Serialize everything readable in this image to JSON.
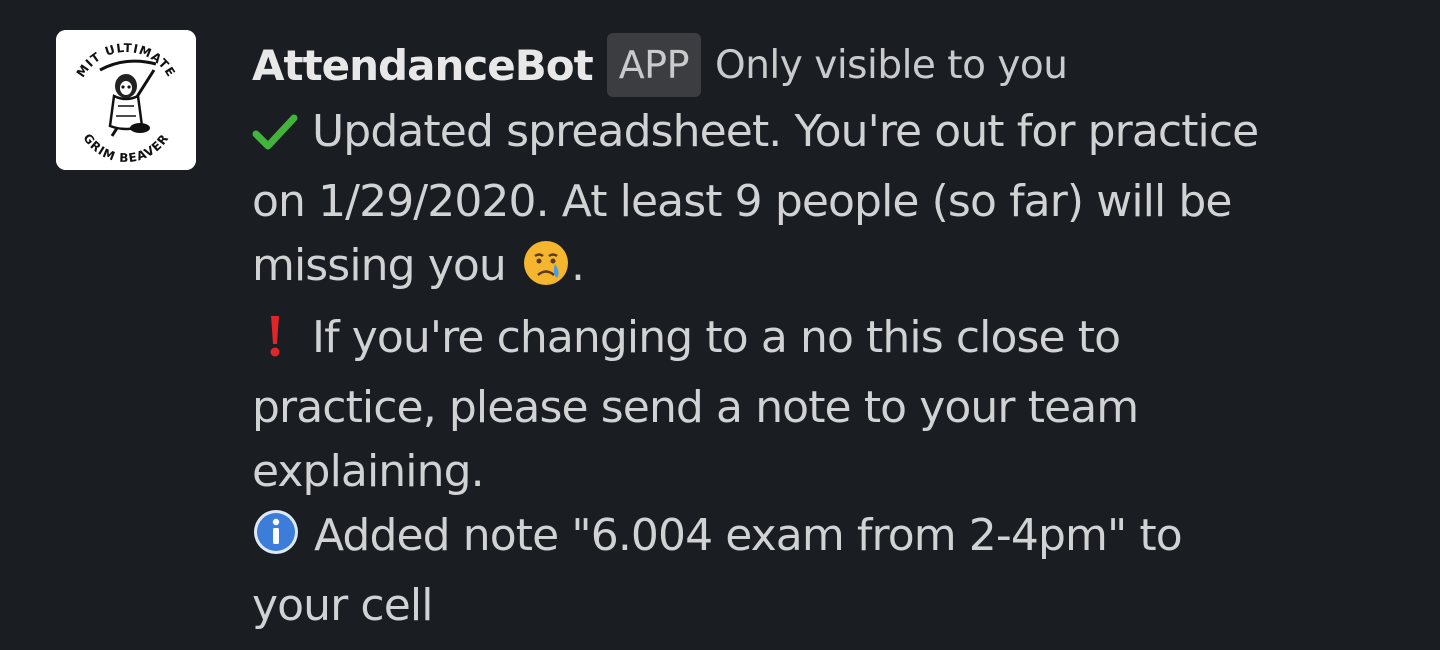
{
  "message": {
    "sender": "AttendanceBot",
    "badge": "APP",
    "visibility": "Only visible to you",
    "avatar": {
      "top_text": "MIT ULTIMATE",
      "bottom_text": "GRIM BEAVER"
    },
    "lines": {
      "l1": "Updated spreadsheet. You're out for practice",
      "l2": "on 1/29/2020. At least 9 people (so far) will be",
      "l3a": "missing you",
      "l3b": ".",
      "l4": "If you're changing to a no this close to",
      "l5": "practice, please send a note to your team",
      "l6": "explaining.",
      "l7": "Added note \"6.004 exam from 2-4pm\" to",
      "l8": "your cell"
    },
    "icons": {
      "check": "check-mark-icon",
      "crying": "crying-face-emoji",
      "exclamation": "exclamation-mark-icon",
      "info": "information-icon"
    },
    "colors": {
      "background": "#1a1d21",
      "text": "#d1d2d3",
      "check": "#44b33e",
      "exclamation": "#e0262a",
      "info": "#3b7dd8"
    }
  }
}
